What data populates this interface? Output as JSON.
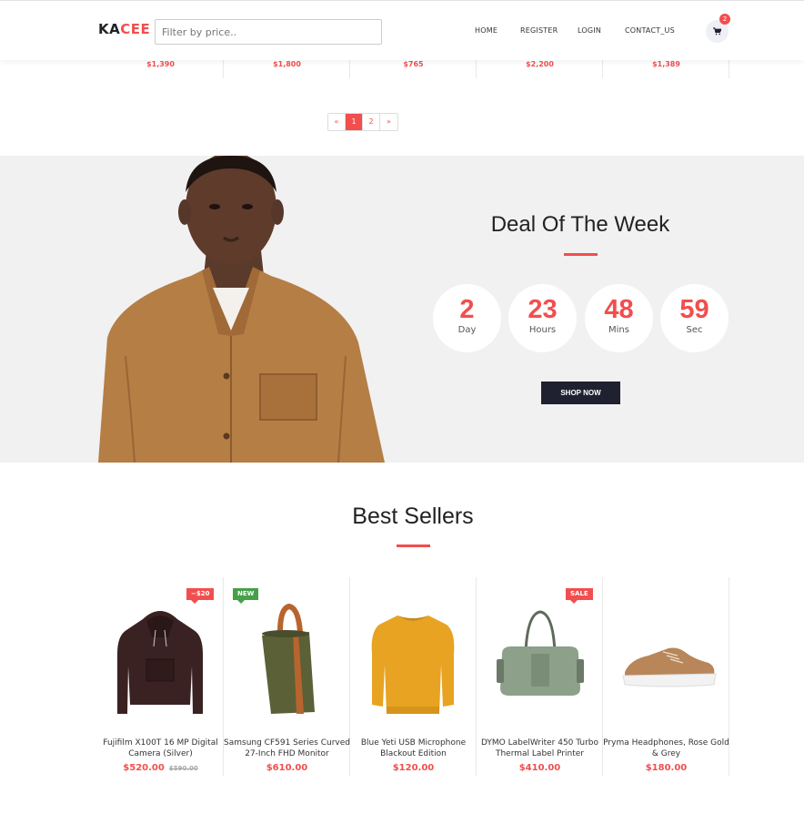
{
  "header": {
    "logo_part1": "KA",
    "logo_part2": "CEE",
    "search_placeholder": "Filter by price..",
    "nav": [
      "HOME",
      "REGISTER",
      "LOGIN",
      "CONTACT_US"
    ],
    "cart_count": "2"
  },
  "top_strip": {
    "prices": [
      "$1,390",
      "$1,800",
      "$765",
      "$2,200",
      "$1,389"
    ]
  },
  "pagination": {
    "prev": "«",
    "pages": [
      "1",
      "2"
    ],
    "next": "»",
    "active_page": "1"
  },
  "deal": {
    "title": "Deal Of The Week",
    "countdown": [
      {
        "value": "2",
        "label": "Day"
      },
      {
        "value": "23",
        "label": "Hours"
      },
      {
        "value": "48",
        "label": "Mins"
      },
      {
        "value": "59",
        "label": "Sec"
      }
    ],
    "button": "SHOP NOW"
  },
  "best_sellers": {
    "title": "Best Sellers",
    "products": [
      {
        "name": "Fujifilm X100T 16 MP Digital Camera (Silver)",
        "price": "$520.00",
        "old_price": "$590.00",
        "tag": "−$20",
        "tag_color": "#f24e4e",
        "icon": "hoodie-image"
      },
      {
        "name": "Samsung CF591 Series Curved 27-Inch FHD Monitor",
        "price": "$610.00",
        "tag": "NEW",
        "tag_color": "#46a049",
        "icon": "bucket-bag-image"
      },
      {
        "name": "Blue Yeti USB Microphone Blackout Edition",
        "price": "$120.00",
        "icon": "sweater-image"
      },
      {
        "name": "DYMO LabelWriter 450 Turbo Thermal Label Printer",
        "price": "$410.00",
        "tag": "SALE",
        "tag_color": "#f24e4e",
        "icon": "duffel-bag-image"
      },
      {
        "name": "Pryma Headphones, Rose Gold & Grey",
        "price": "$180.00",
        "icon": "sneaker-image"
      }
    ]
  },
  "colors": {
    "accent": "#f24e4e",
    "dark_button": "#1f2130",
    "deal_bg": "#f1f1f1"
  }
}
